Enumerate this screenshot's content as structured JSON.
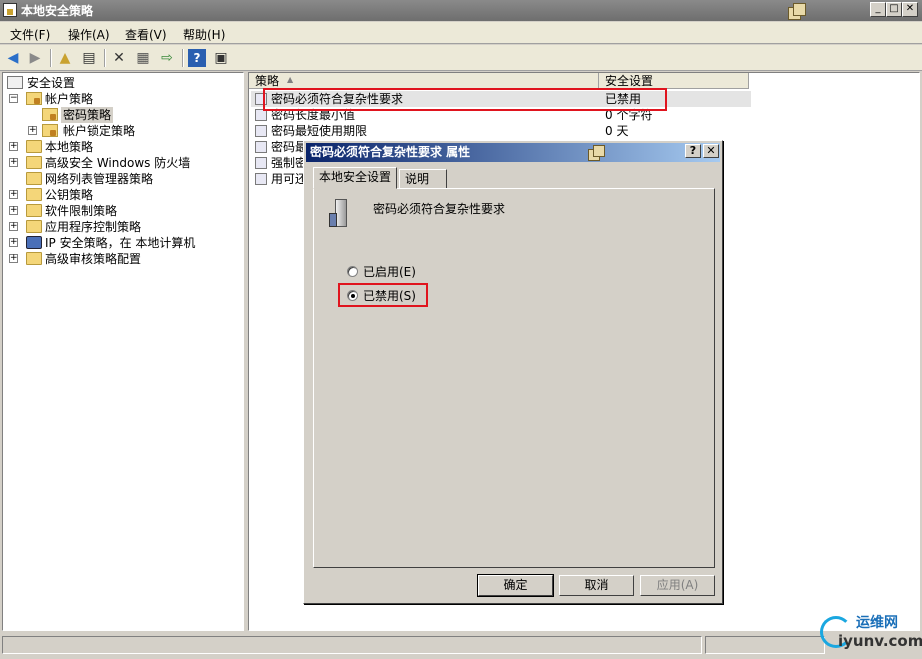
{
  "window": {
    "title": "本地安全策略"
  },
  "window_controls": {
    "minimize": "_",
    "maximize": "□",
    "close": "✕"
  },
  "menu": [
    "文件(F)",
    "操作(A)",
    "查看(V)",
    "帮助(H)"
  ],
  "toolbar": [
    "back-icon",
    "forward-icon",
    "up-folder-icon",
    "show-tree-icon",
    "delete-icon",
    "properties-icon",
    "export-icon",
    "help-icon",
    "console-icon"
  ],
  "tree": [
    {
      "label": "安全设置",
      "level": 0,
      "expander": "",
      "icon": "security-settings-icon"
    },
    {
      "label": "帐户策略",
      "level": 1,
      "expander": "−",
      "icon": "folder-lock-icon"
    },
    {
      "label": "密码策略",
      "level": 2,
      "expander": "",
      "icon": "folder-lock-icon",
      "selected": true
    },
    {
      "label": "帐户锁定策略",
      "level": 2,
      "expander": "+",
      "icon": "folder-lock-icon"
    },
    {
      "label": "本地策略",
      "level": 1,
      "expander": "+",
      "icon": "folder-icon"
    },
    {
      "label": "高级安全 Windows 防火墙",
      "level": 1,
      "expander": "+",
      "icon": "folder-icon"
    },
    {
      "label": "网络列表管理器策略",
      "level": 1,
      "expander": "",
      "icon": "folder-icon"
    },
    {
      "label": "公钥策略",
      "level": 1,
      "expander": "+",
      "icon": "folder-icon"
    },
    {
      "label": "软件限制策略",
      "level": 1,
      "expander": "+",
      "icon": "folder-icon"
    },
    {
      "label": "应用程序控制策略",
      "level": 1,
      "expander": "+",
      "icon": "folder-icon"
    },
    {
      "label": "IP 安全策略，在 本地计算机",
      "level": 1,
      "expander": "+",
      "icon": "ip-security-icon"
    },
    {
      "label": "高级审核策略配置",
      "level": 1,
      "expander": "+",
      "icon": "folder-icon"
    }
  ],
  "list": {
    "columns": [
      "策略",
      "安全设置"
    ],
    "rows": [
      {
        "name": "密码必须符合复杂性要求",
        "value": "已禁用",
        "selected": true
      },
      {
        "name": "密码长度最小值",
        "value": "0 个字符"
      },
      {
        "name": "密码最短使用期限",
        "value": "0 天"
      },
      {
        "name": "密码最",
        "value": ""
      },
      {
        "name": "强制密",
        "value": ""
      },
      {
        "name": "用可还",
        "value": ""
      }
    ]
  },
  "dialog": {
    "title": "密码必须符合复杂性要求 属性",
    "help_btn": "?",
    "close_btn": "✕",
    "tabs": [
      "本地安全设置",
      "说明"
    ],
    "policy_name": "密码必须符合复杂性要求",
    "options": [
      {
        "label": "已启用(E)",
        "checked": false
      },
      {
        "label": "已禁用(S)",
        "checked": true
      }
    ],
    "buttons": {
      "ok": "确定",
      "cancel": "取消",
      "apply": "应用(A)"
    }
  },
  "watermark": {
    "cn": "运维网",
    "url": "iyunv.com"
  },
  "colors": {
    "highlight": "#e0141e",
    "dialog_title": "#0a246a"
  }
}
